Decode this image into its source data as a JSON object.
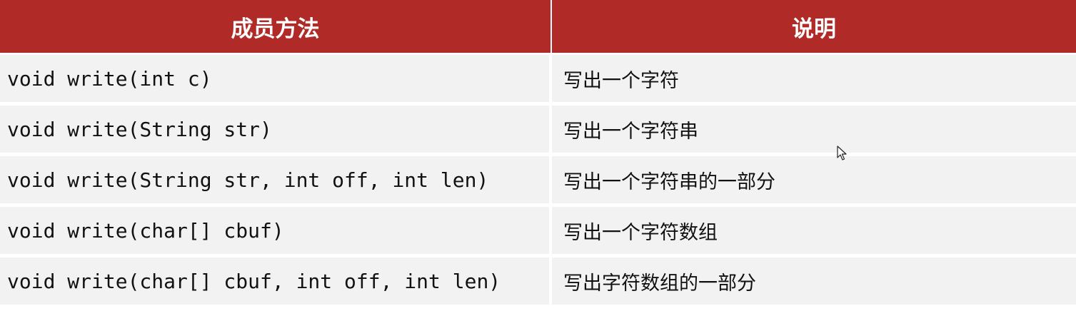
{
  "table": {
    "headers": {
      "method": "成员方法",
      "description": "说明"
    },
    "rows": [
      {
        "method": "void write(int c)",
        "description": "写出一个字符"
      },
      {
        "method": "void write(String str)",
        "description": "写出一个字符串"
      },
      {
        "method": "void write(String str, int off, int len)",
        "description": "写出一个字符串的一部分"
      },
      {
        "method": "void write(char[] cbuf)",
        "description": "写出一个字符数组"
      },
      {
        "method": "void write(char[] cbuf, int off, int len)",
        "description": "写出字符数组的一部分"
      }
    ]
  },
  "colors": {
    "header_background": "#b02a27",
    "header_text": "#ffffff",
    "row_background": "#f2f2f2"
  },
  "icons": {
    "cursor": "mouse-pointer-icon"
  }
}
